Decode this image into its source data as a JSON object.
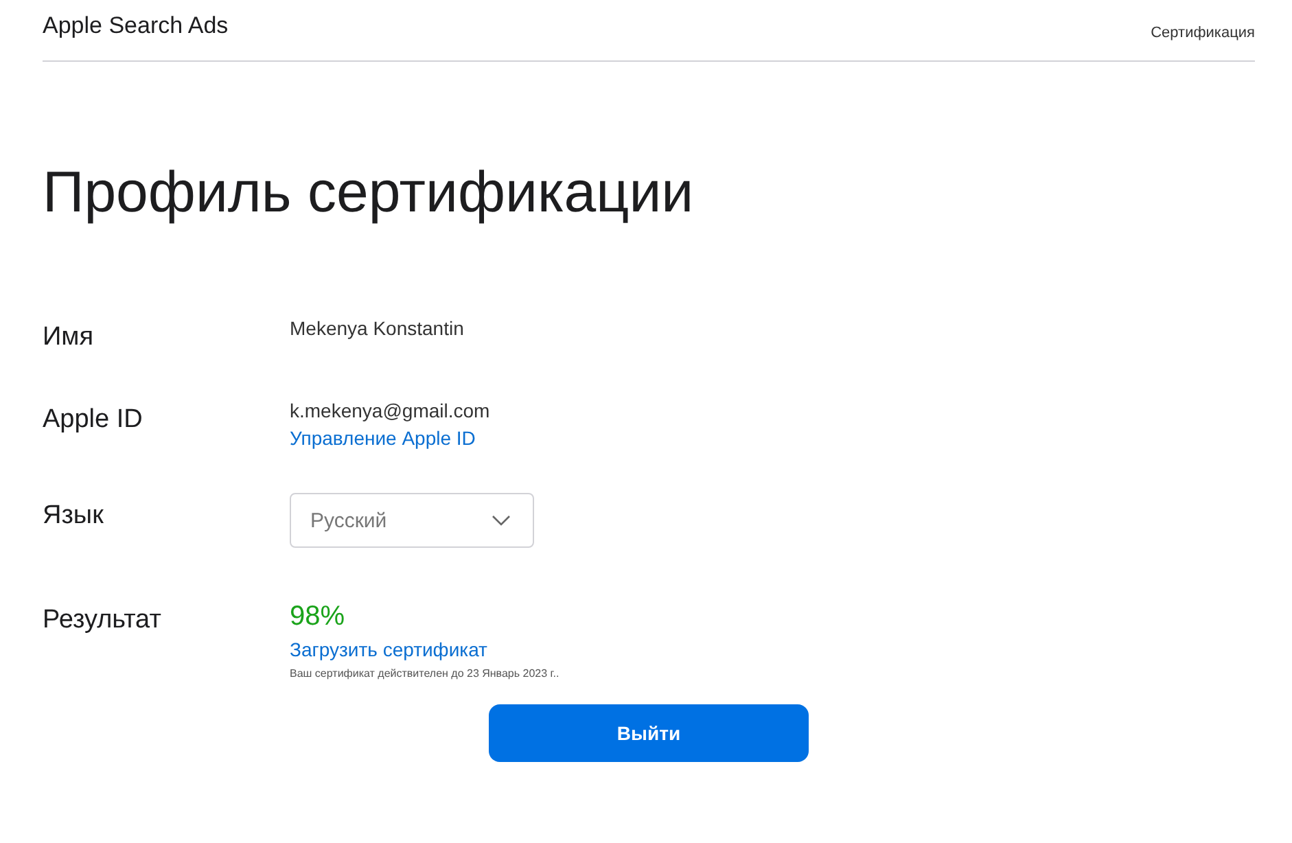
{
  "header": {
    "brand": "Apple Search Ads",
    "nav_link": "Сертификация"
  },
  "title": "Профиль сертификации",
  "fields": [
    {
      "kind": "text",
      "label": "Имя",
      "value": "Mekenya Konstantin"
    },
    {
      "kind": "account",
      "label": "Apple ID",
      "value": "k.mekenya@gmail.com",
      "link": "Управление Apple ID"
    },
    {
      "kind": "select",
      "label": "Язык",
      "value": "Русский"
    },
    {
      "kind": "result",
      "label": "Результат",
      "value": "98%",
      "link": "Загрузить сертификат",
      "note": "Ваш сертификат действителен до 23 Январь 2023 г.."
    }
  ],
  "button": "Выйти"
}
